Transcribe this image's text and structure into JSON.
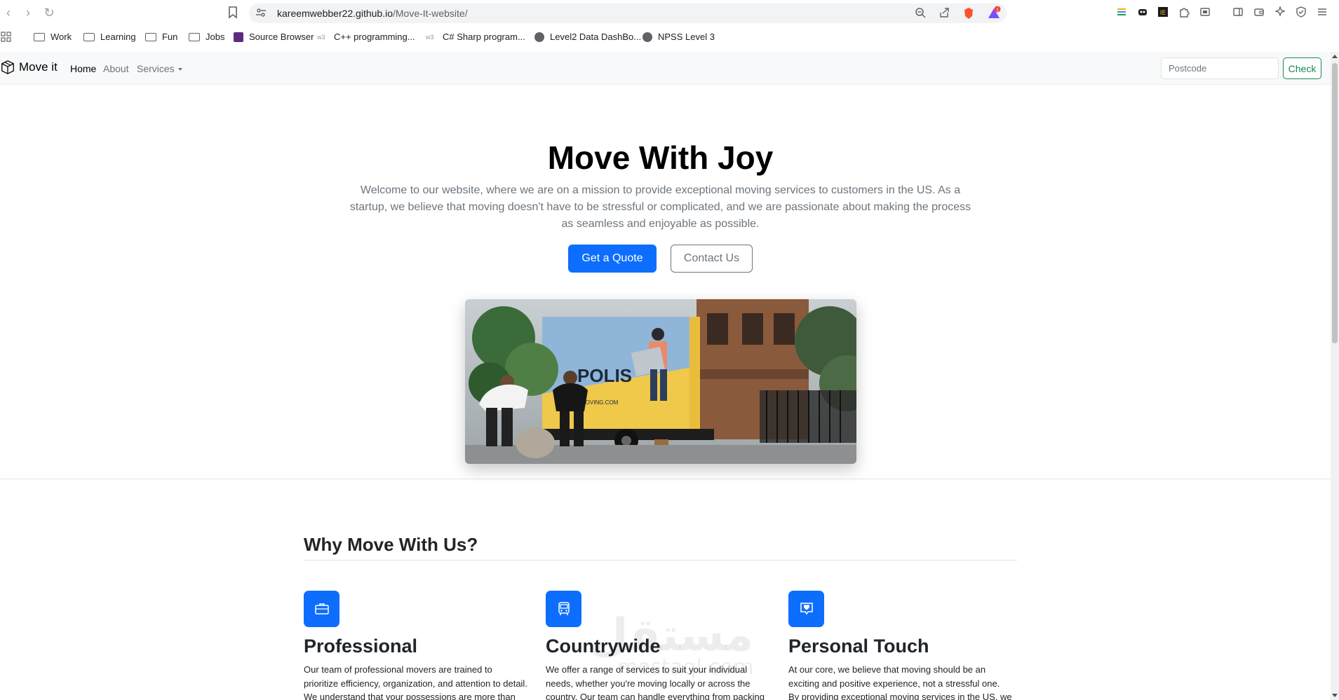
{
  "browser": {
    "url_host": "kareemwebber22.github.io",
    "url_path": "/Move-It-website/",
    "bookmarks": [
      {
        "label": "Work",
        "icon": "folder-icon"
      },
      {
        "label": "Learning",
        "icon": "folder-icon"
      },
      {
        "label": "Fun",
        "icon": "folder-icon"
      },
      {
        "label": "Jobs",
        "icon": "folder-icon"
      },
      {
        "label": "Source Browser",
        "icon": "net-icon"
      },
      {
        "label": "C++ programming...",
        "icon": "w3-icon"
      },
      {
        "label": "C# Sharp program...",
        "icon": "w3-icon"
      },
      {
        "label": "Level2 Data DashBo...",
        "icon": "globe-icon"
      },
      {
        "label": "NPSS Level 3",
        "icon": "globe-icon"
      }
    ],
    "notification_count": "1"
  },
  "navbar": {
    "brand": "Move it",
    "links": [
      {
        "label": "Home",
        "active": true
      },
      {
        "label": "About",
        "active": false
      },
      {
        "label": "Services",
        "active": false
      }
    ],
    "postcode_placeholder": "Postcode",
    "check_label": "Check"
  },
  "hero": {
    "title": "Move With Joy",
    "lead": "Welcome to our website, where we are on a mission to provide exceptional moving services to customers in the US. As a startup, we believe that moving doesn't have to be stressful or complicated, and we are passionate about making the process as seamless and enjoyable as possible.",
    "primary_button": "Get a Quote",
    "secondary_button": "Contact Us",
    "truck_text": "POLIS",
    "truck_site": "MOVING.COM"
  },
  "features": {
    "heading": "Why Move With Us?",
    "items": [
      {
        "icon": "briefcase-icon",
        "title": "Professional",
        "text": "Our team of professional movers are trained to prioritize efficiency, organization, and attention to detail. We understand that your possessions are more than just"
      },
      {
        "icon": "bus-icon",
        "title": "Countrywide",
        "text": "We offer a range of services to suit your individual needs, whether you're moving locally or across the country. Our team can handle everything from packing and loading to"
      },
      {
        "icon": "heart-chat-icon",
        "title": "Personal Touch",
        "text": "At our core, we believe that moving should be an exciting and positive experience, not a stressful one. By providing exceptional moving services in the US, we hope to"
      }
    ]
  },
  "watermark": {
    "main": "مستقل",
    "sub": "mostaql.com"
  },
  "colors": {
    "primary": "#0d6efd",
    "success": "#198754",
    "muted": "#6c757d"
  }
}
